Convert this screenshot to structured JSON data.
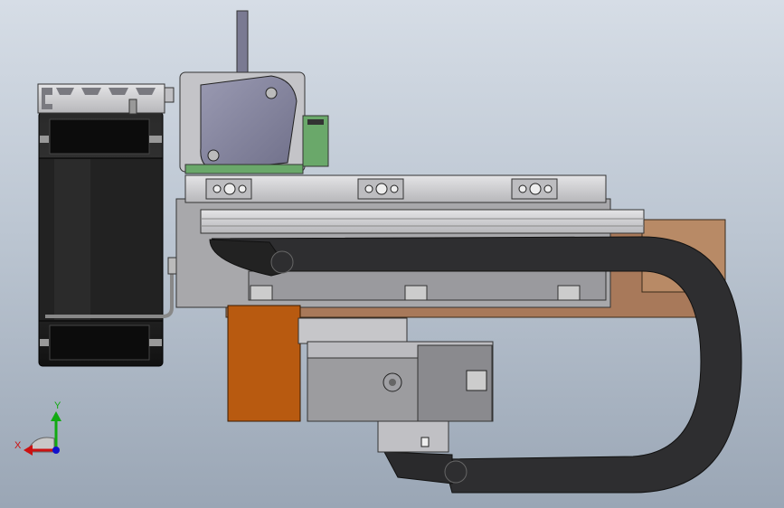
{
  "triad": {
    "x_label": "X",
    "y_label": "Y"
  },
  "colors": {
    "background_top": "#d6dde6",
    "background_bottom": "#9aa6b5",
    "aluminum": "#c9c9cc",
    "dark_part": "#1c1c1c",
    "cable_chain": "#2e2e30",
    "copper_plate": "#a8795a",
    "orange_block": "#b85a10",
    "motor_body": "#8e8ea4",
    "pcb_green": "#6aa86a",
    "x_axis": "#cc1111",
    "y_axis": "#11aa11",
    "z_axis": "#1111cc"
  }
}
